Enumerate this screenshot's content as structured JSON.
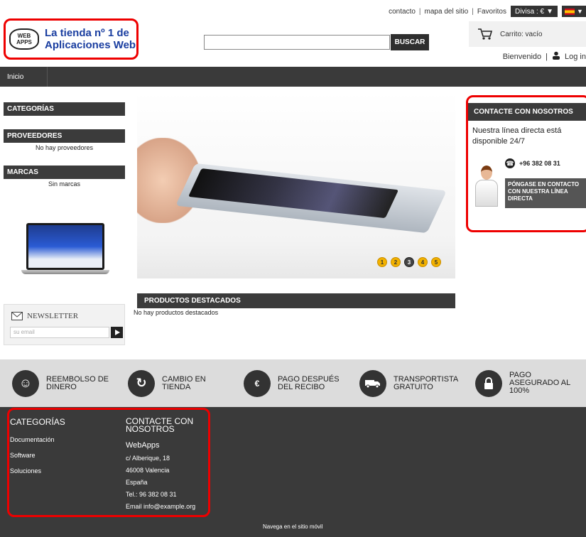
{
  "topbar": {
    "links": [
      "contacto",
      "mapa del sitio",
      "Favoritos"
    ],
    "currency": "Divisa : €"
  },
  "logo": {
    "badge_top": "WEB",
    "badge_bottom": "APPS",
    "line1": "La tienda nº 1 de",
    "line2": "Aplicaciones Web"
  },
  "search": {
    "button": "BUSCAR",
    "value": ""
  },
  "cart": {
    "label": "Carrito: vacío"
  },
  "header": {
    "welcome": "Bienvenido",
    "login": "Log in"
  },
  "nav": {
    "home": "Inicio"
  },
  "left": {
    "categories": "CATEGORÍAS",
    "suppliers": "PROVEEDORES",
    "suppliers_empty": "No hay proveedores",
    "brands": "MARCAS",
    "brands_empty": "Sin marcas"
  },
  "newsletter": {
    "title": "NEWSLETTER",
    "placeholder": "su email"
  },
  "slider": {
    "dots": [
      "1",
      "2",
      "3",
      "4",
      "5"
    ],
    "active_index": 2
  },
  "featured": {
    "title": "PRODUCTOS DESTACADOS",
    "empty": "No hay productos destacados"
  },
  "contact": {
    "title": "CONTACTE CON NOSOTROS",
    "text": "Nuestra línea directa está disponible 24/7",
    "phone": "+96 382 08 31",
    "button": "PÓNGASE EN CONTACTO CON NUESTRA LÍNEA DIRECTA"
  },
  "features": [
    {
      "label": "REEMBOLSO DE\nDINERO",
      "icon": "smiley-icon"
    },
    {
      "label": "CAMBIO EN\nTIENDA",
      "icon": "refresh-icon"
    },
    {
      "label": "PAGO DESPUÉS\nDEL RECIBO",
      "icon": "cash-icon"
    },
    {
      "label": "TRANSPORTISTA\nGRATUITO",
      "icon": "truck-icon"
    },
    {
      "label": "PAGO\nASEGURADO AL\n100%",
      "icon": "lock-icon"
    }
  ],
  "footer": {
    "categories_title": "CATEGORÍAS",
    "categories": [
      "Documentación",
      "Software",
      "Soluciones"
    ],
    "contact_title": "CONTACTE CON\nNOSOTROS",
    "company": "WebApps",
    "address": [
      "c/ Alberique, 18",
      "46008 Valencia",
      "España",
      "Tel.: 96 382 08 31",
      "Email info@example.org"
    ],
    "mobile": "Navega en el sitio móvil"
  }
}
